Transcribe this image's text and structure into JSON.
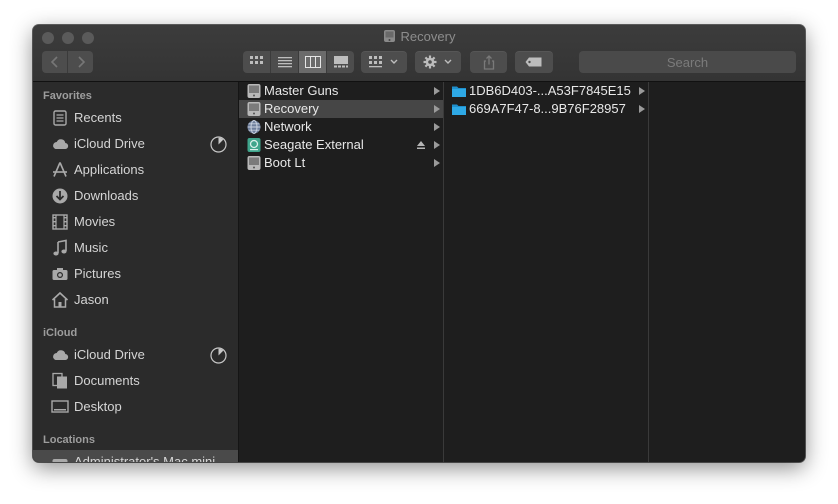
{
  "window": {
    "title": "Recovery"
  },
  "toolbar": {
    "search_placeholder": "Search"
  },
  "sidebar": {
    "favorites_header": "Favorites",
    "favorites": [
      {
        "label": "Recents",
        "icon": "recents-icon"
      },
      {
        "label": "iCloud Drive",
        "icon": "cloud-icon",
        "progress": "pie"
      },
      {
        "label": "Applications",
        "icon": "applications-icon"
      },
      {
        "label": "Downloads",
        "icon": "download-icon"
      },
      {
        "label": "Movies",
        "icon": "film-icon"
      },
      {
        "label": "Music",
        "icon": "music-note-icon"
      },
      {
        "label": "Pictures",
        "icon": "camera-icon"
      },
      {
        "label": "Jason",
        "icon": "home-icon"
      }
    ],
    "icloud_header": "iCloud",
    "icloud": [
      {
        "label": "iCloud Drive",
        "icon": "cloud-icon",
        "progress": "pie"
      },
      {
        "label": "Documents",
        "icon": "documents-icon"
      },
      {
        "label": "Desktop",
        "icon": "desktop-icon"
      }
    ],
    "locations_header": "Locations",
    "locations": [
      {
        "label": "Administrator's Mac mini",
        "icon": "computer-icon"
      }
    ]
  },
  "columns": {
    "col1": [
      {
        "label": "Master Guns",
        "icon": "drive-icon"
      },
      {
        "label": "Recovery",
        "icon": "drive-icon",
        "selected": true
      },
      {
        "label": "Network",
        "icon": "network-globe-icon"
      },
      {
        "label": "Seagate External",
        "icon": "external-drive-icon",
        "ejectable": true
      },
      {
        "label": "Boot Lt",
        "icon": "drive-icon"
      }
    ],
    "col2": [
      {
        "label": "1DB6D403-...A53F7845E15",
        "icon": "folder-icon"
      },
      {
        "label": "669A7F47-8...9B76F28957",
        "icon": "folder-icon"
      }
    ]
  },
  "colors": {
    "folder": "#2ea9e6",
    "window_bg": "#1e1e1e",
    "sidebar_bg": "#2b2b2b",
    "selection": "#464646"
  }
}
